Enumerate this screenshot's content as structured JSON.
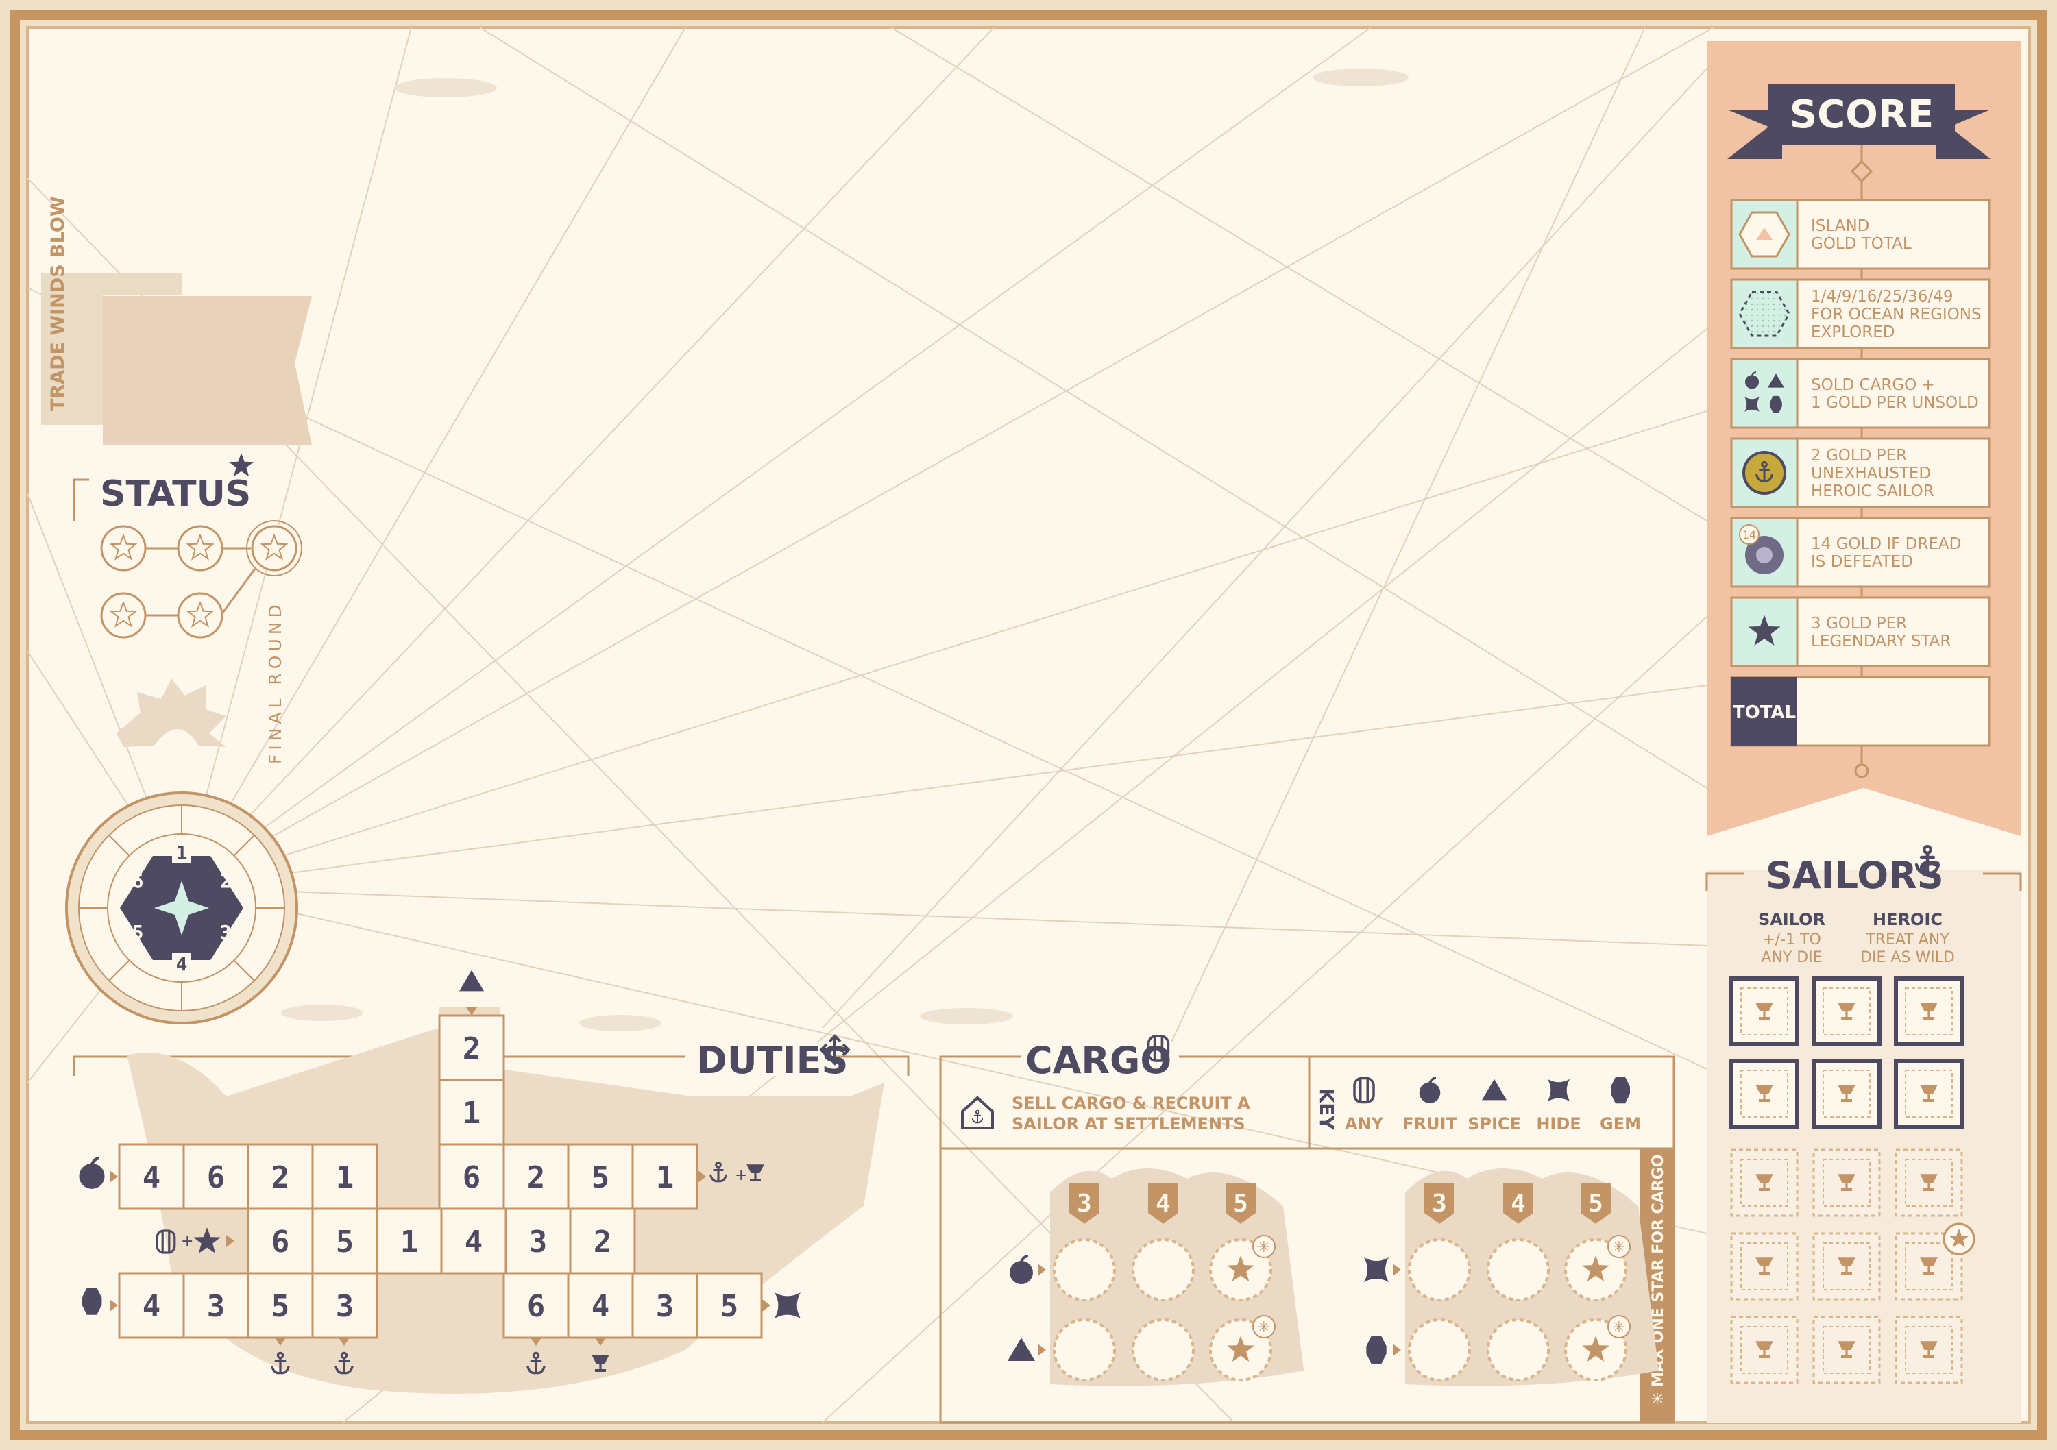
{
  "colors": {
    "parchment": "#fdf7ec",
    "border": "#c9955e",
    "navy": "#4e4a62",
    "tan": "#c29466",
    "peach": "#f2c2a4",
    "mint": "#d4efe3"
  },
  "trade_winds": {
    "label": "TRADE WINDS BLOW"
  },
  "status": {
    "title": "STATUS",
    "final_round": "FINAL ROUND"
  },
  "compass": {
    "numbers": [
      "1",
      "2",
      "3",
      "4",
      "5",
      "6"
    ]
  },
  "score": {
    "title": "SCORE",
    "rows": [
      {
        "icon": "island-hex-icon",
        "text": "ISLAND\nGOLD TOTAL"
      },
      {
        "icon": "ocean-hex-icon",
        "text": "1/4/9/16/25/36/49\nFOR OCEAN REGIONS\nEXPLORED"
      },
      {
        "icon": "cargo-goods-icon",
        "text": "SOLD CARGO +\n1 GOLD PER UNSOLD"
      },
      {
        "icon": "anchor-coin-icon",
        "text": "2 GOLD PER\nUNEXHAUSTED\nHEROIC SAILOR"
      },
      {
        "icon": "dread-token-icon",
        "badge": "14",
        "text": "14 GOLD IF DREAD\nIS DEFEATED"
      },
      {
        "icon": "star-icon",
        "text": "3 GOLD PER\nLEGENDARY STAR"
      }
    ],
    "total_label": "TOTAL"
  },
  "sailors": {
    "title": "SAILORS",
    "sailor_label": "SAILOR",
    "sailor_desc": "+/-1 TO\nANY DIE",
    "heroic_label": "HEROIC",
    "heroic_desc": "TREAT ANY\nDIE AS WILD"
  },
  "duties": {
    "title": "DUTIES",
    "mast": [
      "2",
      "1"
    ],
    "row1": {
      "left": [
        "4",
        "6",
        "2",
        "1"
      ],
      "right": [
        "6",
        "2",
        "5",
        "1"
      ]
    },
    "row2": [
      "6",
      "5",
      "1",
      "4",
      "3",
      "2"
    ],
    "row3": {
      "left": [
        "4",
        "3",
        "5",
        "3"
      ],
      "right": [
        "6",
        "4",
        "3",
        "5"
      ]
    }
  },
  "cargo": {
    "title": "CARGO",
    "sell_text": "SELL CARGO & RECRUIT A\nSAILOR AT SETTLEMENTS",
    "key_label": "KEY",
    "key": [
      {
        "icon": "barrel-icon",
        "label": "ANY"
      },
      {
        "icon": "fruit-icon",
        "label": "FRUIT"
      },
      {
        "icon": "spice-icon",
        "label": "SPICE"
      },
      {
        "icon": "hide-icon",
        "label": "HIDE"
      },
      {
        "icon": "gem-icon",
        "label": "GEM"
      }
    ],
    "ship_prices": [
      "3",
      "4",
      "5"
    ],
    "max_note": "✳ MAX ONE STAR FOR CARGO"
  }
}
